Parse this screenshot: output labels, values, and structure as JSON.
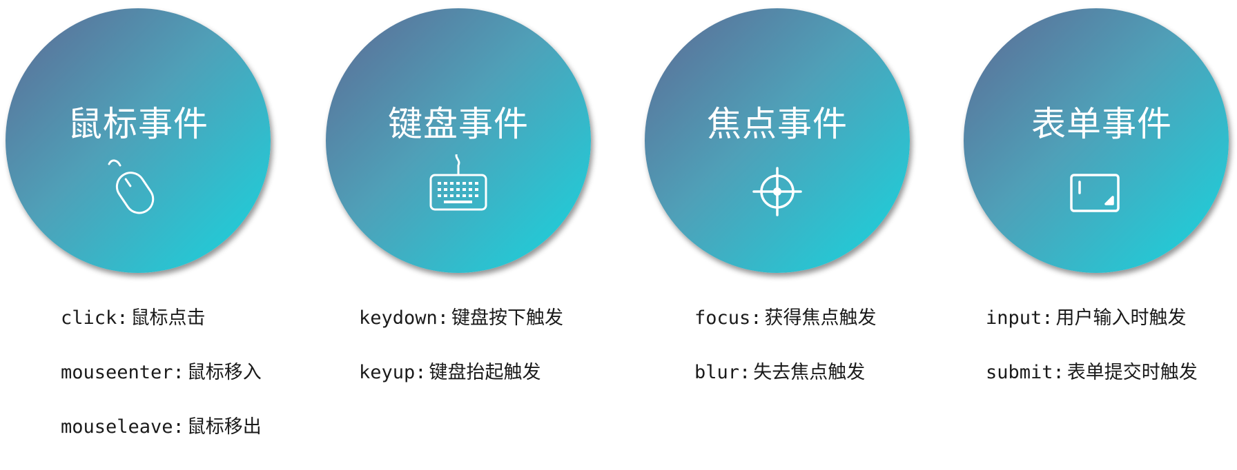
{
  "categories": [
    {
      "title": "鼠标事件",
      "icon": "mouse-icon",
      "events": [
        {
          "name": "click:",
          "desc": "鼠标点击"
        },
        {
          "name": "mouseenter:",
          "desc": "鼠标移入"
        },
        {
          "name": "mouseleave:",
          "desc": "鼠标移出"
        }
      ]
    },
    {
      "title": "键盘事件",
      "icon": "keyboard-icon",
      "events": [
        {
          "name": "keydown:",
          "desc": "键盘按下触发"
        },
        {
          "name": "keyup:",
          "desc": "键盘抬起触发"
        }
      ]
    },
    {
      "title": "焦点事件",
      "icon": "crosshair-icon",
      "events": [
        {
          "name": "focus:",
          "desc": "获得焦点触发"
        },
        {
          "name": "blur:",
          "desc": "失去焦点触发"
        }
      ]
    },
    {
      "title": "表单事件",
      "icon": "form-icon",
      "events": [
        {
          "name": "input:",
          "desc": "用户输入时触发"
        },
        {
          "name": "submit:",
          "desc": "表单提交时触发"
        }
      ]
    }
  ]
}
